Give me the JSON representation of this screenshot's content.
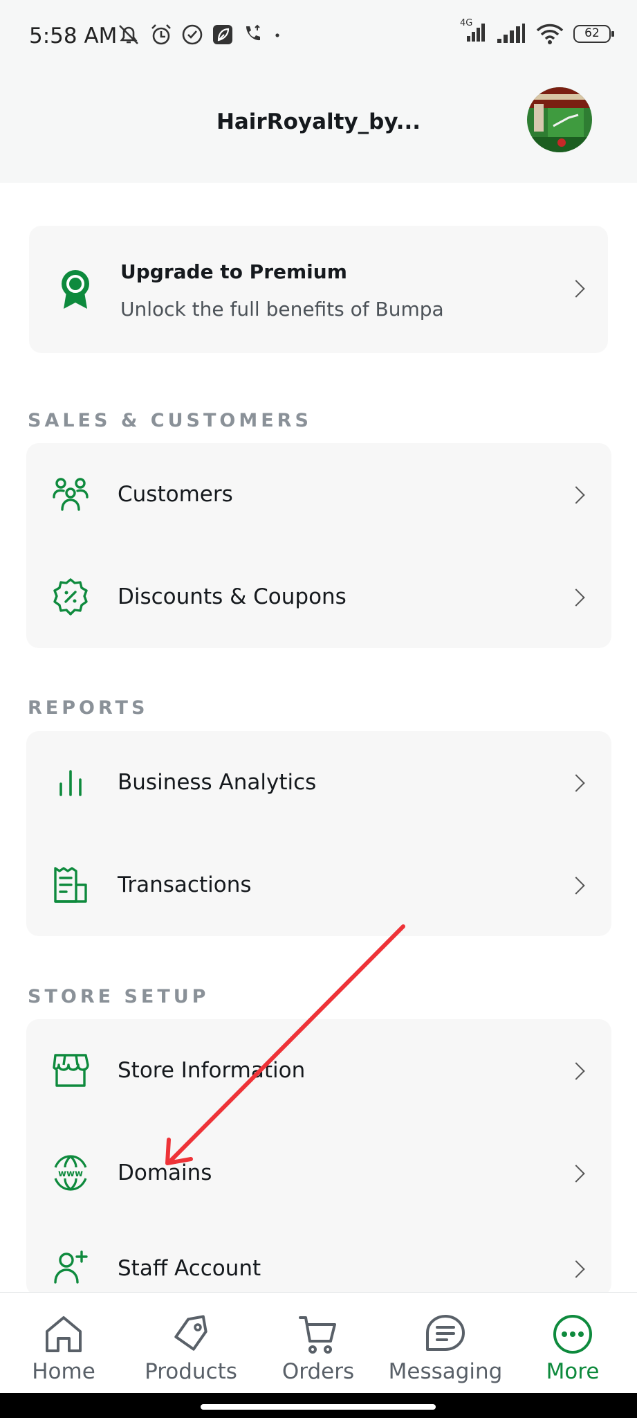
{
  "status_bar": {
    "time": "5:58 AM",
    "network_label": "4G",
    "battery": "62",
    "left_icons": [
      "mute-icon",
      "alarm-icon",
      "check-circle-icon",
      "leaf-icon",
      "call-icon",
      "dot-icon"
    ],
    "right_icons": [
      "signal-icon",
      "signal-icon",
      "wifi-icon",
      "battery-icon"
    ]
  },
  "header": {
    "title": "HairRoyalty_by..."
  },
  "premium": {
    "title": "Upgrade to Premium",
    "subtitle": "Unlock the full benefits of Bumpa"
  },
  "sections": {
    "sales": {
      "label": "SALES & CUSTOMERS",
      "items": [
        {
          "label": "Customers",
          "icon": "customers-icon"
        },
        {
          "label": "Discounts & Coupons",
          "icon": "discount-icon"
        }
      ]
    },
    "reports": {
      "label": "REPORTS",
      "items": [
        {
          "label": "Business Analytics",
          "icon": "analytics-icon"
        },
        {
          "label": "Transactions",
          "icon": "receipt-icon"
        }
      ]
    },
    "store": {
      "label": "STORE SETUP",
      "items": [
        {
          "label": "Store Information",
          "icon": "store-icon"
        },
        {
          "label": "Domains",
          "icon": "globe-www-icon"
        },
        {
          "label": "Staff Account",
          "icon": "add-user-icon"
        }
      ]
    }
  },
  "bottom_nav": {
    "items": [
      {
        "label": "Home",
        "icon": "home-icon"
      },
      {
        "label": "Products",
        "icon": "tag-icon"
      },
      {
        "label": "Orders",
        "icon": "cart-icon"
      },
      {
        "label": "Messaging",
        "icon": "message-icon"
      },
      {
        "label": "More",
        "icon": "more-icon"
      }
    ],
    "active": "More"
  },
  "colors": {
    "brand_green": "#0e8a3d",
    "annotation_red": "#ee3338"
  }
}
